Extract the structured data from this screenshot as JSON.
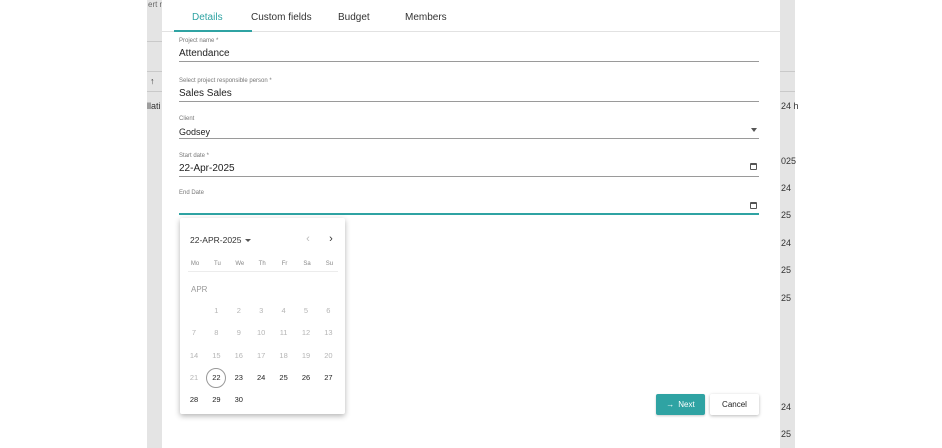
{
  "tabs": [
    "Details",
    "Custom fields",
    "Budget",
    "Members"
  ],
  "fields": {
    "project_name": {
      "label": "Project name *",
      "value": "Attendance"
    },
    "responsible": {
      "label": "Select project responsible person *",
      "value": "Sales Sales"
    },
    "client": {
      "label": "Client",
      "value": "Godsey"
    },
    "start_date": {
      "label": "Start date *",
      "value": "22-Apr-2025"
    },
    "end_date": {
      "label": "End Date",
      "value": ""
    }
  },
  "datepicker": {
    "period_label": "22-APR-2025",
    "month_label": "APR",
    "weekdays": [
      "Mo",
      "Tu",
      "We",
      "Th",
      "Fr",
      "Sa",
      "Su"
    ],
    "min_date": 22,
    "today": 22,
    "days": [
      [
        null,
        "1",
        "2",
        "3",
        "4",
        "5",
        "6"
      ],
      [
        "7",
        "8",
        "9",
        "10",
        "11",
        "12",
        "13"
      ],
      [
        "14",
        "15",
        "16",
        "17",
        "18",
        "19",
        "20"
      ],
      [
        "21",
        "22",
        "23",
        "24",
        "25",
        "26",
        "27"
      ],
      [
        "28",
        "29",
        "30",
        null,
        null,
        null,
        null
      ]
    ]
  },
  "buttons": {
    "next": "Next",
    "cancel": "Cancel"
  },
  "background": {
    "top_left_fragment": "ert n",
    "left_arrow": "↑",
    "left_fragment": "llati",
    "right_fragments": [
      "24 h",
      "025",
      "24",
      "25",
      "24",
      "25",
      "25",
      "24",
      "25"
    ]
  },
  "icons": {
    "nav_prev": "chevron-left-icon",
    "nav_next": "chevron-right-icon",
    "next_arrow": "arrow-right-icon",
    "calendar": "calendar-icon",
    "dropdown": "caret-down-icon"
  },
  "colors": {
    "accent": "#2fa3a3",
    "overlay": "#e4e4e4"
  }
}
